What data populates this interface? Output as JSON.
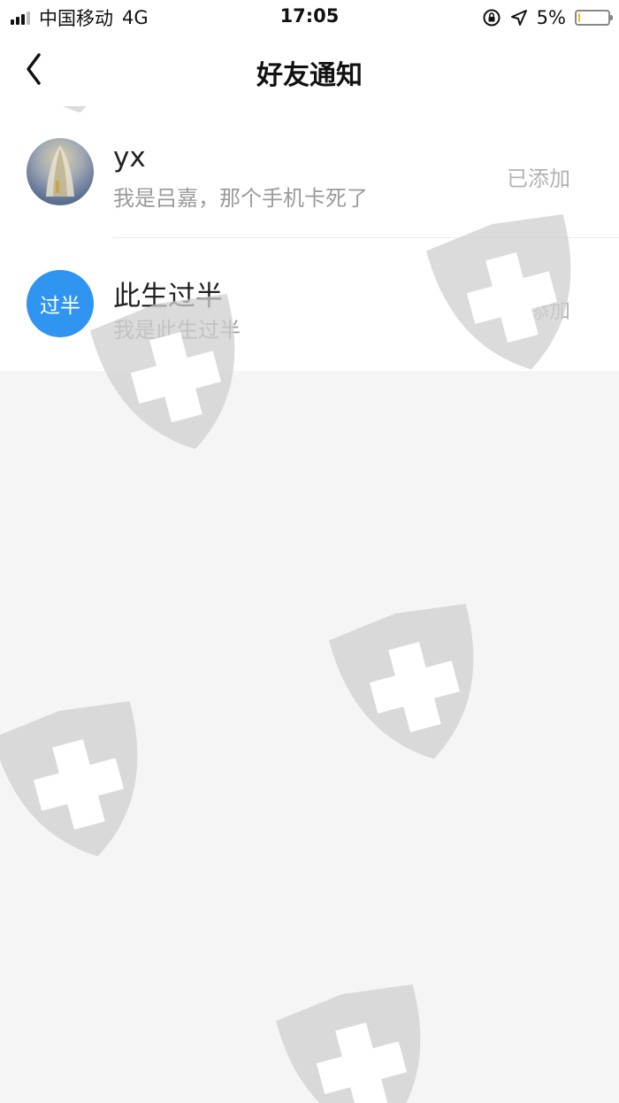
{
  "status_bar": {
    "carrier": "中国移动",
    "network": "4G",
    "time": "17:05",
    "battery": "5%",
    "battery_level": 0.05
  },
  "nav": {
    "title": "好友通知",
    "back_icon": "chevron-left-icon"
  },
  "notifications": [
    {
      "name": "yx",
      "message": "我是吕嘉，那个手机卡死了",
      "status": "已添加",
      "avatar_type": "photo"
    },
    {
      "name": "此生过半",
      "message": "我是此生过半",
      "status": "已添加",
      "avatar_text": "过半",
      "avatar_color": "#2f95f1"
    }
  ],
  "colors": {
    "accent": "#2f95f1",
    "background": "#f5f5f5",
    "watermark": "#d6d6d6"
  },
  "watermark_icon": "shield-plus-icon"
}
